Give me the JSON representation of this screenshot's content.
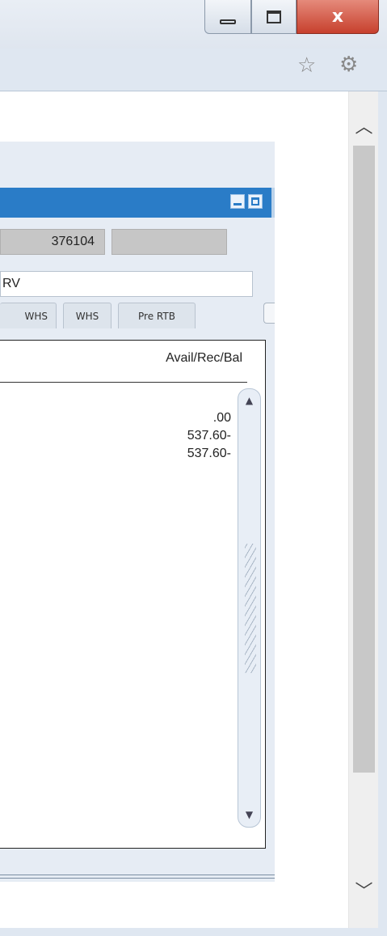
{
  "window": {
    "controls": {
      "minimize_icon": "minimize-icon",
      "maximize_icon": "maximize-icon",
      "close_label": "x"
    },
    "toolbar": {
      "bookmark_icon": "star-icon",
      "settings_icon": "gear-icon"
    }
  },
  "app": {
    "header_color": "#2a7cc7",
    "doc_number": "376104",
    "description": "RV",
    "tabs": [
      "WHS",
      "WHS",
      "Pre RTB"
    ],
    "grid": {
      "column_header": "Avail/Rec/Bal",
      "rows": [
        ".00",
        "537.60-",
        "537.60-"
      ]
    }
  }
}
